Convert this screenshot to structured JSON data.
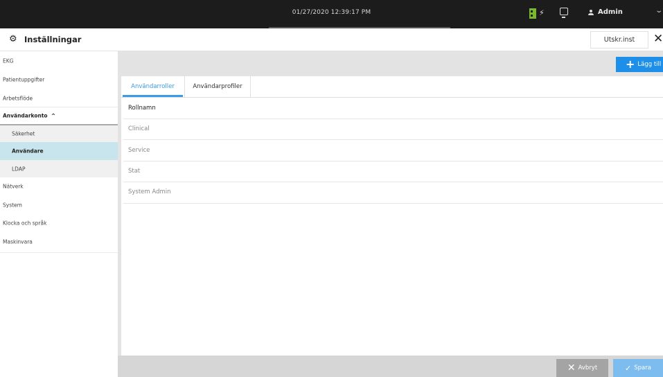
{
  "topbar": {
    "datetime": "01/27/2020 12:39:17 PM",
    "battery_icon": "battery-icon",
    "charging_icon": "bolt-icon",
    "monitor_icon": "monitor-icon",
    "user_icon": "user-icon",
    "user_name": "Admin",
    "user_menu_icon": "chevron-down-icon"
  },
  "titlebar": {
    "icon": "gear-icon",
    "title": "Inställningar",
    "print_label": "Utskr.inst",
    "close_icon": "close-icon"
  },
  "sidebar": {
    "items": [
      {
        "label": "EKG"
      },
      {
        "label": "Patientuppgifter"
      },
      {
        "label": "Arbetsflöde"
      },
      {
        "label": "Användarkonto",
        "expanded": true
      },
      {
        "label": "Säkerhet"
      },
      {
        "label": "Användare",
        "active": true
      },
      {
        "label": "LDAP"
      },
      {
        "label": "Nätverk"
      },
      {
        "label": "System"
      },
      {
        "label": "Klocka och språk"
      },
      {
        "label": "Maskinvara"
      }
    ],
    "collapse_glyph": "^"
  },
  "toolbar": {
    "add_label": "Lägg till",
    "add_icon": "plus-icon"
  },
  "tabs": [
    {
      "label": "Användarroller",
      "active": true
    },
    {
      "label": "Användarprofiler",
      "active": false
    }
  ],
  "table": {
    "column_header": "Rollnamn",
    "rows": [
      "Clinical",
      "Service",
      "Stat",
      "System Admin"
    ]
  },
  "footer": {
    "cancel_label": "Avbryt",
    "save_label": "Spara"
  },
  "colors": {
    "accent": "#1e8fe8",
    "active_sidebar": "#c8e5ee",
    "topbar": "#1c1c1c",
    "battery": "#7ab82e"
  }
}
